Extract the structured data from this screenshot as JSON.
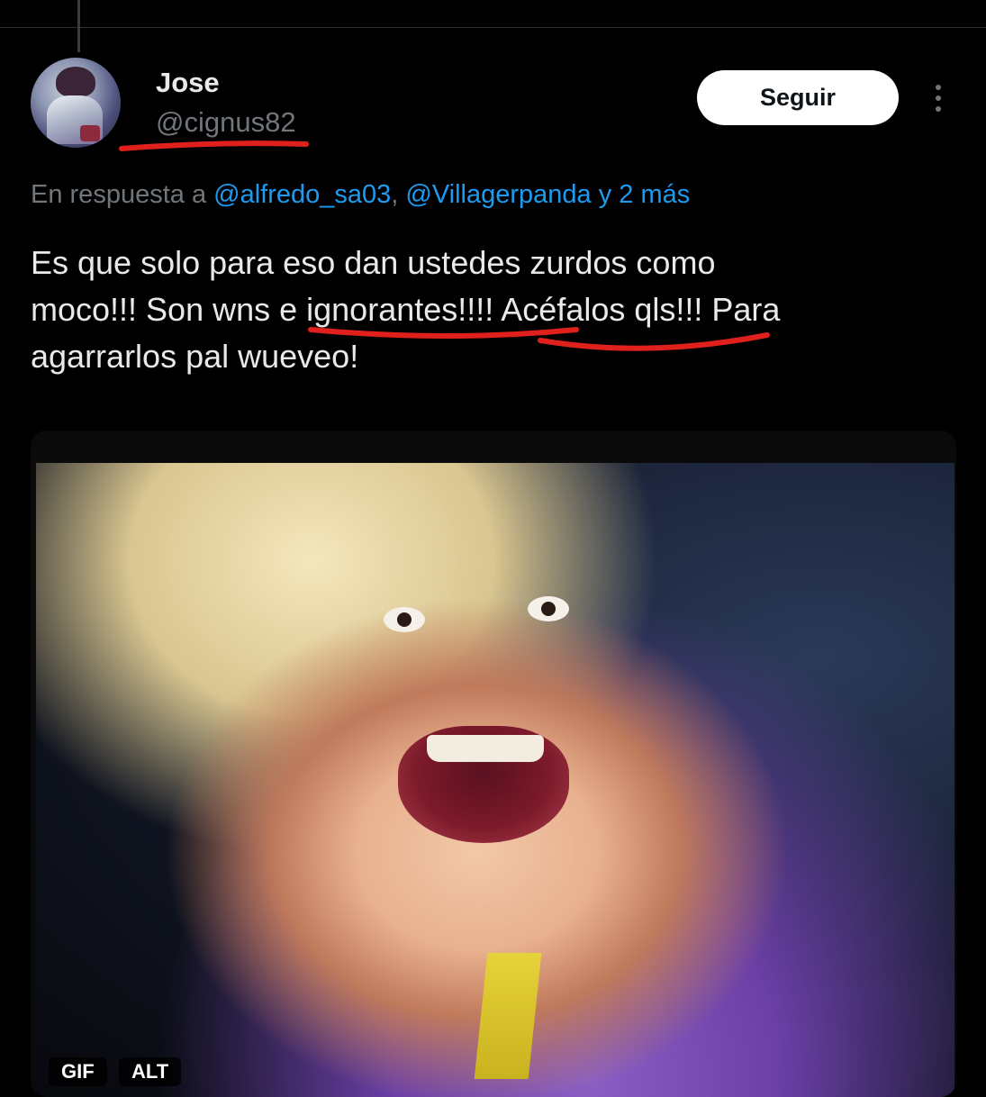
{
  "tweet": {
    "author": {
      "display_name": "Jose",
      "handle": "@cignus82"
    },
    "follow_label": "Seguir",
    "more_icon": "more-dots-icon",
    "reply_context": {
      "prefix": "En respuesta a ",
      "mentions": [
        "@alfredo_sa03",
        "@Villagerpanda"
      ],
      "separator": ", ",
      "suffix": " y 2 más"
    },
    "text_lines": [
      "Es que solo para eso dan ustedes zurdos como",
      "moco!!! Son wns e ignorantes!!!! Acéfalos qls!!! Para",
      "agarrarlos pal wueveo!"
    ],
    "media": {
      "badges": [
        "GIF",
        "ALT"
      ]
    }
  },
  "colors": {
    "background": "#000000",
    "text_primary": "#e7e9ea",
    "text_secondary": "#71767b",
    "link": "#1d9bf0",
    "annotation_underline": "#e0201c"
  }
}
